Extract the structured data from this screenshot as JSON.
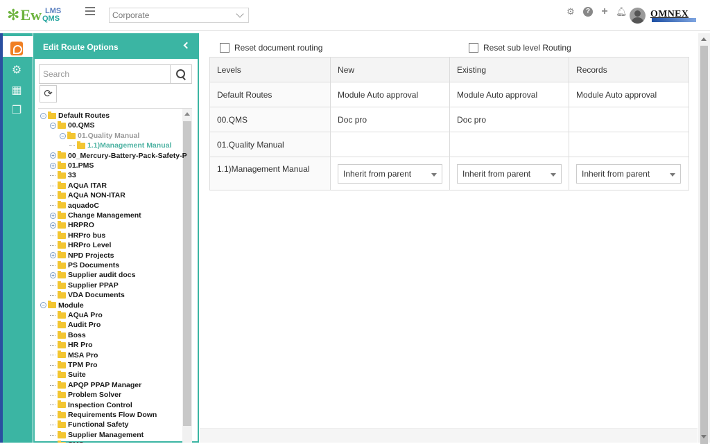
{
  "app": {
    "logo_main": "Ew",
    "logo_sup": "LMS",
    "logo_sub": "QMS",
    "org_select": "Corporate",
    "brand": "OMNEX"
  },
  "colors": {
    "accent": "#3bb5a3",
    "rail_border": "#2a4fa0",
    "folder": "#f3c531",
    "selected": "#4fb3a3"
  },
  "topbar_icons": [
    "gear-icon",
    "help-icon",
    "plus-icon",
    "bell-icon",
    "user-avatar"
  ],
  "rail_icons": [
    "document-icon",
    "settings-cog-icon",
    "building-icon",
    "copy-icon"
  ],
  "panel": {
    "title": "Edit Route Options",
    "search_placeholder": "Search",
    "tree": [
      {
        "label": "Default Routes",
        "toggle": "minus",
        "folder": true
      },
      {
        "label": "00.QMS",
        "toggle": "minus",
        "folder": true
      },
      {
        "label": "01.Quality Manual",
        "toggle": "minus",
        "folder": true
      },
      {
        "label": "1.1)Management Manual",
        "toggle": "",
        "folder": true
      },
      {
        "label": "00_Mercury-Battery-Pack-Safety-P",
        "toggle": "plus",
        "folder": true
      },
      {
        "label": "01.PMS",
        "toggle": "plus",
        "folder": true
      },
      {
        "label": "33",
        "toggle": "",
        "folder": true
      },
      {
        "label": "AQuA ITAR",
        "toggle": "",
        "folder": true
      },
      {
        "label": "AQuA NON-ITAR",
        "toggle": "",
        "folder": true
      },
      {
        "label": "aquadoC",
        "toggle": "",
        "folder": true
      },
      {
        "label": "Change Management",
        "toggle": "plus",
        "folder": true
      },
      {
        "label": "HRPRO",
        "toggle": "plus",
        "folder": true
      },
      {
        "label": "HRPro bus",
        "toggle": "",
        "folder": true
      },
      {
        "label": "HRPro Level",
        "toggle": "",
        "folder": true
      },
      {
        "label": "NPD Projects",
        "toggle": "plus",
        "folder": true
      },
      {
        "label": "PS Documents",
        "toggle": "",
        "folder": true
      },
      {
        "label": "Supplier audit docs",
        "toggle": "plus",
        "folder": true
      },
      {
        "label": "Supplier PPAP",
        "toggle": "",
        "folder": true
      },
      {
        "label": "VDA Documents",
        "toggle": "",
        "folder": true
      },
      {
        "label": "Module",
        "toggle": "minus",
        "folder": true
      },
      {
        "label": "AQuA Pro",
        "toggle": "",
        "folder": true
      },
      {
        "label": "Audit Pro",
        "toggle": "",
        "folder": true
      },
      {
        "label": "Boss",
        "toggle": "",
        "folder": true
      },
      {
        "label": "HR Pro",
        "toggle": "",
        "folder": true
      },
      {
        "label": "MSA Pro",
        "toggle": "",
        "folder": true
      },
      {
        "label": "TPM Pro",
        "toggle": "",
        "folder": true
      },
      {
        "label": "Suite",
        "toggle": "",
        "folder": true
      },
      {
        "label": "APQP PPAP Manager",
        "toggle": "",
        "folder": true
      },
      {
        "label": "Problem Solver",
        "toggle": "",
        "folder": true
      },
      {
        "label": "Inspection Control",
        "toggle": "",
        "folder": true
      },
      {
        "label": "Requirements Flow Down",
        "toggle": "",
        "folder": true
      },
      {
        "label": "Functional Safety",
        "toggle": "",
        "folder": true
      },
      {
        "label": "Supplier Management",
        "toggle": "",
        "folder": true
      },
      {
        "label": "SMS",
        "toggle": "",
        "folder": true
      }
    ]
  },
  "options": {
    "reset_document_routing": "Reset document routing",
    "reset_sub_level_routing": "Reset sub level Routing"
  },
  "table": {
    "headers": [
      "Levels",
      "New",
      "Existing",
      "Records"
    ],
    "rows": [
      {
        "level": "Default Routes",
        "new": "Module Auto approval",
        "existing": "Module Auto approval",
        "records": "Module Auto approval"
      },
      {
        "level": "00.QMS",
        "new": "Doc pro",
        "existing": "Doc pro",
        "records": ""
      },
      {
        "level": "01.Quality Manual",
        "new": "",
        "existing": "",
        "records": ""
      },
      {
        "level": "1.1)Management Manual",
        "new": "Inherit from parent",
        "existing": "Inherit from parent",
        "records": "Inherit from parent"
      }
    ]
  }
}
